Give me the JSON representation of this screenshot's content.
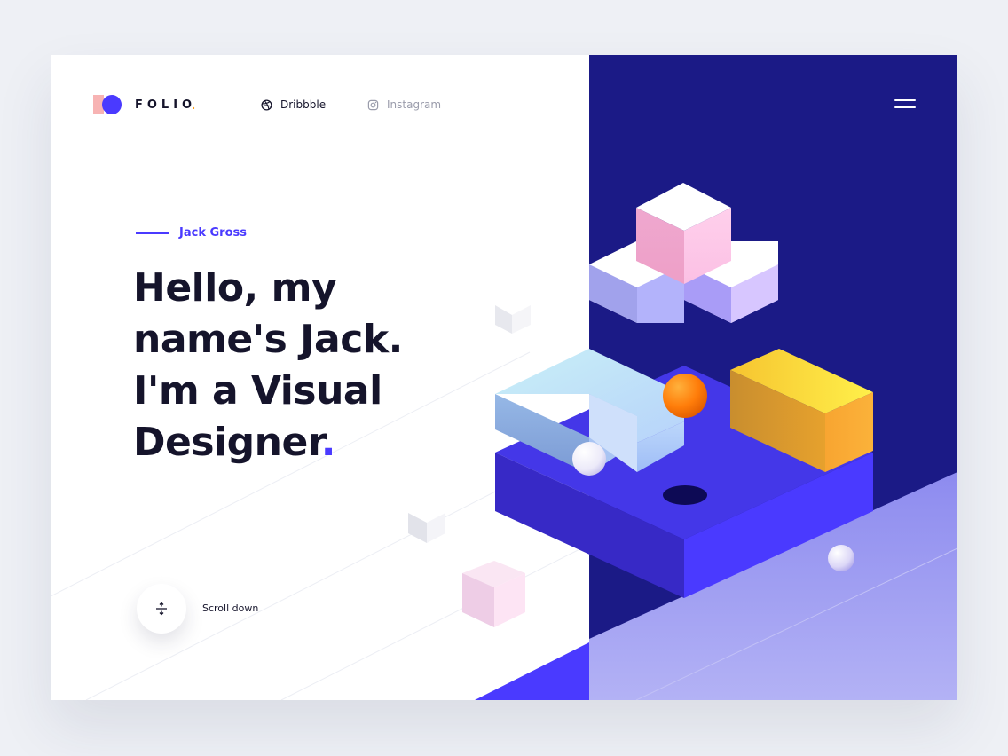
{
  "header": {
    "logo_text": "FOLIO",
    "logo_dot": ".",
    "nav": [
      {
        "label": "Dribbble",
        "icon": "dribbble-icon"
      },
      {
        "label": "Instagram",
        "icon": "instagram-icon"
      }
    ],
    "menu_icon": "hamburger-menu-icon"
  },
  "hero": {
    "eyebrow": "Jack Gross",
    "headline_lines": [
      "Hello, my",
      "name's Jack.",
      "I'm a Visual",
      "Designer"
    ],
    "headline_dot": "."
  },
  "scroll": {
    "label": "Scroll down",
    "icon": "scroll-arrows-icon"
  },
  "colors": {
    "accent": "#4a3aff",
    "dark_panel": "#1b1a86",
    "text": "#15142b",
    "muted": "#9a9cab",
    "logo_square": "#f7b3b3",
    "logo_dot": "#ff9f1a"
  }
}
